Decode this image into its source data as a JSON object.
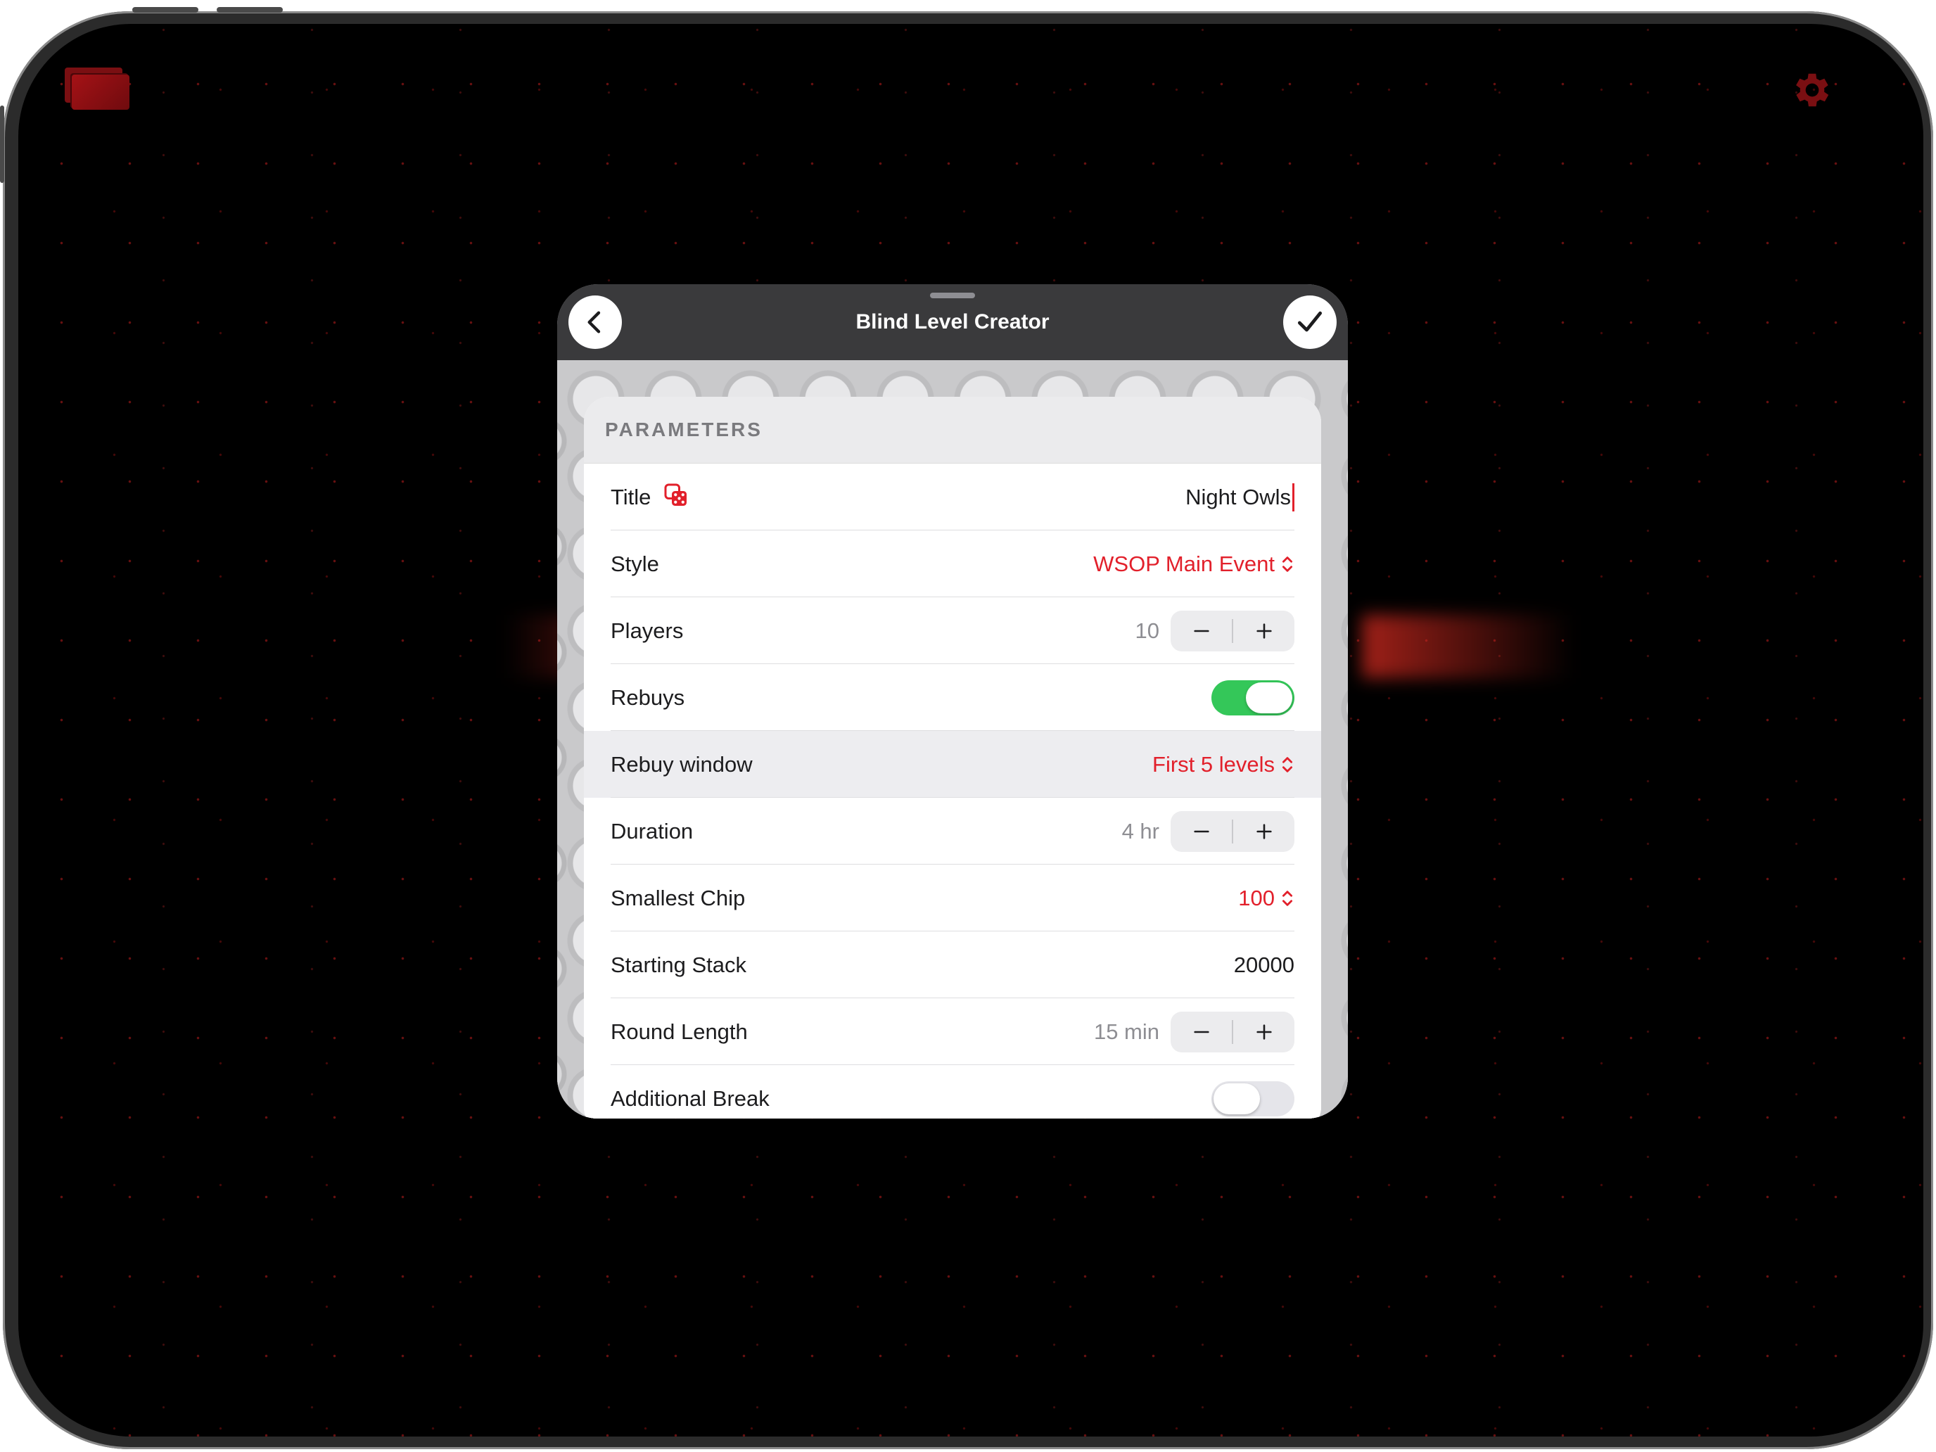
{
  "modal": {
    "title": "Blind Level Creator"
  },
  "section": {
    "header": "PARAMETERS"
  },
  "rows": {
    "title": {
      "label": "Title",
      "value": "Night Owls"
    },
    "style": {
      "label": "Style",
      "value": "WSOP Main Event"
    },
    "players": {
      "label": "Players",
      "value": "10"
    },
    "rebuys": {
      "label": "Rebuys",
      "toggle": "on"
    },
    "rebuy_window": {
      "label": "Rebuy window",
      "value": "First 5 levels"
    },
    "duration": {
      "label": "Duration",
      "value": "4 hr"
    },
    "smallest_chip": {
      "label": "Smallest Chip",
      "value": "100"
    },
    "starting_stack": {
      "label": "Starting Stack",
      "value": "20000"
    },
    "round_length": {
      "label": "Round Length",
      "value": "15 min"
    },
    "additional_break": {
      "label": "Additional Break",
      "toggle": "off"
    }
  },
  "icons": {
    "app_logo": "cards-icon",
    "settings": "gear-icon",
    "back": "chevron-left-icon",
    "done": "checkmark-icon",
    "random_title": "dice-icon",
    "picker": "chevron-up-down-icon",
    "decrement": "minus-icon",
    "increment": "plus-icon"
  },
  "colors": {
    "accent": "#e2202b",
    "toggle_on": "#34c759",
    "header_bg": "#3a3a3c",
    "background": "#000000"
  }
}
